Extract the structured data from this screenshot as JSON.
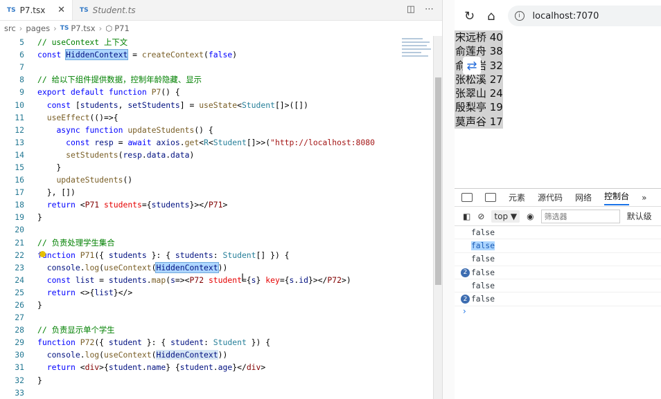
{
  "editor": {
    "tabs": [
      {
        "icon": "TS",
        "label": "P7.tsx",
        "close": "✕"
      },
      {
        "icon": "TS",
        "label": "Student.ts"
      }
    ],
    "breadcrumb": {
      "parts": [
        "src",
        "pages"
      ],
      "file_icon": "TS",
      "file": "P7.tsx",
      "symbol": "P71"
    },
    "lines": [
      {
        "n": "5",
        "html": "<span class='c'>// useContext 上下文</span>"
      },
      {
        "n": "6",
        "html": "<span class='k'>const</span> <span class='v hl'>HiddenContext</span> = <span class='f'>createContext</span>(<span class='k'>false</span>)"
      },
      {
        "n": "7",
        "html": ""
      },
      {
        "n": "8",
        "html": "<span class='c'>// 给以下组件提供数据，控制年龄隐藏、显示</span>"
      },
      {
        "n": "9",
        "html": "<span class='k'>export default function</span> <span class='f'>P7</span>() {"
      },
      {
        "n": "10",
        "html": "  <span class='k'>const</span> [<span class='v'>students</span>, <span class='v'>setStudents</span>] = <span class='f'>useState</span>&lt;<span class='t'>Student</span>[]&gt;([])"
      },
      {
        "n": "11",
        "html": "  <span class='f'>useEffect</span>(()=&gt;{"
      },
      {
        "n": "12",
        "html": "    <span class='k'>async function</span> <span class='f'>updateStudents</span>() {"
      },
      {
        "n": "13",
        "html": "      <span class='k'>const</span> <span class='v'>resp</span> = <span class='k'>await</span> <span class='v'>axios</span>.<span class='f'>get</span>&lt;<span class='t'>R</span>&lt;<span class='t'>Student</span>[]&gt;&gt;(<span class='s'>\"http://localhost:8080</span>"
      },
      {
        "n": "14",
        "html": "      <span class='f'>setStudents</span>(<span class='v'>resp</span>.<span class='v'>data</span>.<span class='v'>data</span>)"
      },
      {
        "n": "15",
        "html": "    }"
      },
      {
        "n": "16",
        "html": "    <span class='f'>updateStudents</span>()"
      },
      {
        "n": "17",
        "html": "  }, [])"
      },
      {
        "n": "18",
        "html": "  <span class='k'>return</span> &lt;<span class='tg'>P71</span> <span class='at'>students</span>={<span class='v'>students</span>}&gt;&lt;/<span class='tg'>P71</span>&gt;"
      },
      {
        "n": "19",
        "html": "}"
      },
      {
        "n": "20",
        "html": ""
      },
      {
        "n": "21",
        "html": "<span class='c'>// 负责处理学生集合</span>"
      },
      {
        "n": "22",
        "html": "<span class='k'>function</span> <span class='f'>P71</span>({ <span class='v'>students</span> }: { <span class='v'>students</span>: <span class='t'>Student</span>[] }) {"
      },
      {
        "n": "23",
        "html": "  <span class='v'>console</span>.<span class='f'>log</span>(<span class='f'>useContext</span>(<span class='v hl'>HiddenContext</span>))"
      },
      {
        "n": "24",
        "html": "  <span class='k'>const</span> <span class='v'>list</span> = <span class='v'>students</span>.<span class='f'>map</span>(<span class='v'>s</span>=&gt;&lt;<span class='tg'>P72</span> <span class='at'>student</span>={<span class='v'>s</span>} <span class='at'>key</span>={<span class='v'>s</span>.<span class='v'>id</span>}&gt;&lt;/<span class='tg'>P72</span>&gt;)"
      },
      {
        "n": "25",
        "html": "  <span class='k'>return</span> &lt;&gt;{<span class='v'>list</span>}&lt;/&gt;"
      },
      {
        "n": "26",
        "html": "}"
      },
      {
        "n": "27",
        "html": ""
      },
      {
        "n": "28",
        "html": "<span class='c'>// 负责显示单个学生</span>"
      },
      {
        "n": "29",
        "html": "<span class='k'>function</span> <span class='f'>P72</span>({ <span class='v'>student</span> }: { <span class='v'>student</span>: <span class='t'>Student</span> }) {"
      },
      {
        "n": "30",
        "html": "  <span class='v'>console</span>.<span class='f'>log</span>(<span class='f'>useContext</span>(<span class='v hl2'>HiddenContext</span>))"
      },
      {
        "n": "31",
        "html": "  <span class='k'>return</span> &lt;<span class='tg'>div</span>&gt;{<span class='v'>student</span>.<span class='v'>name</span>} {<span class='v'>student</span>.<span class='v'>age</span>}&lt;/<span class='tg'>div</span>&gt;"
      },
      {
        "n": "32",
        "html": "}"
      },
      {
        "n": "33",
        "html": ""
      }
    ]
  },
  "browser": {
    "url": "localhost:7070",
    "students": [
      "宋远桥 40",
      "俞莲舟 38",
      "俞岱岩 32",
      "张松溪 27",
      "张翠山 24",
      "殷梨亭 19",
      "莫声谷 17"
    ]
  },
  "devtools": {
    "tabs": [
      "元素",
      "源代码",
      "网络",
      "控制台"
    ],
    "more": "»",
    "context": "top ▼",
    "filter_placeholder": "筛选器",
    "levels": "默认级",
    "logs": [
      {
        "text": "false",
        "badge": ""
      },
      {
        "text": "false",
        "badge": "",
        "selected": true
      },
      {
        "text": "false",
        "badge": ""
      },
      {
        "text": "false",
        "badge": "2"
      },
      {
        "text": "false",
        "badge": ""
      },
      {
        "text": "false",
        "badge": "2"
      }
    ],
    "prompt": "›"
  },
  "colors": {
    "keyword": "#0000ff",
    "function": "#795e26",
    "comment": "#008000",
    "string": "#a31515"
  }
}
